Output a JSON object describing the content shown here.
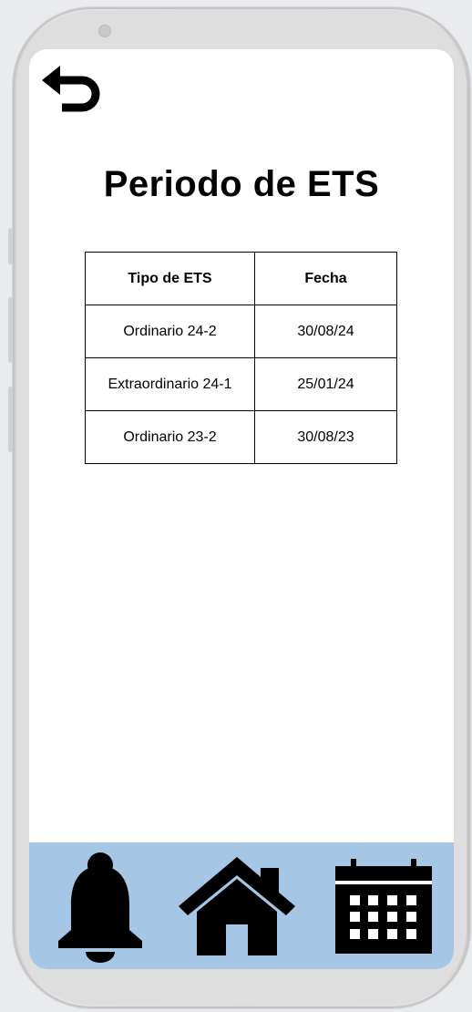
{
  "page": {
    "title": "Periodo de ETS"
  },
  "table": {
    "headers": [
      "Tipo de ETS",
      "Fecha"
    ],
    "rows": [
      [
        "Ordinario 24-2",
        "30/08/24"
      ],
      [
        "Extraordinario 24-1",
        "25/01/24"
      ],
      [
        "Ordinario 23-2",
        "30/08/23"
      ]
    ]
  },
  "nav": {
    "items": [
      {
        "icon": "bell-icon"
      },
      {
        "icon": "home-icon"
      },
      {
        "icon": "calendar-icon"
      }
    ],
    "background": "#a6c6e6"
  },
  "icons": {
    "back": "undo-arrow-icon"
  }
}
